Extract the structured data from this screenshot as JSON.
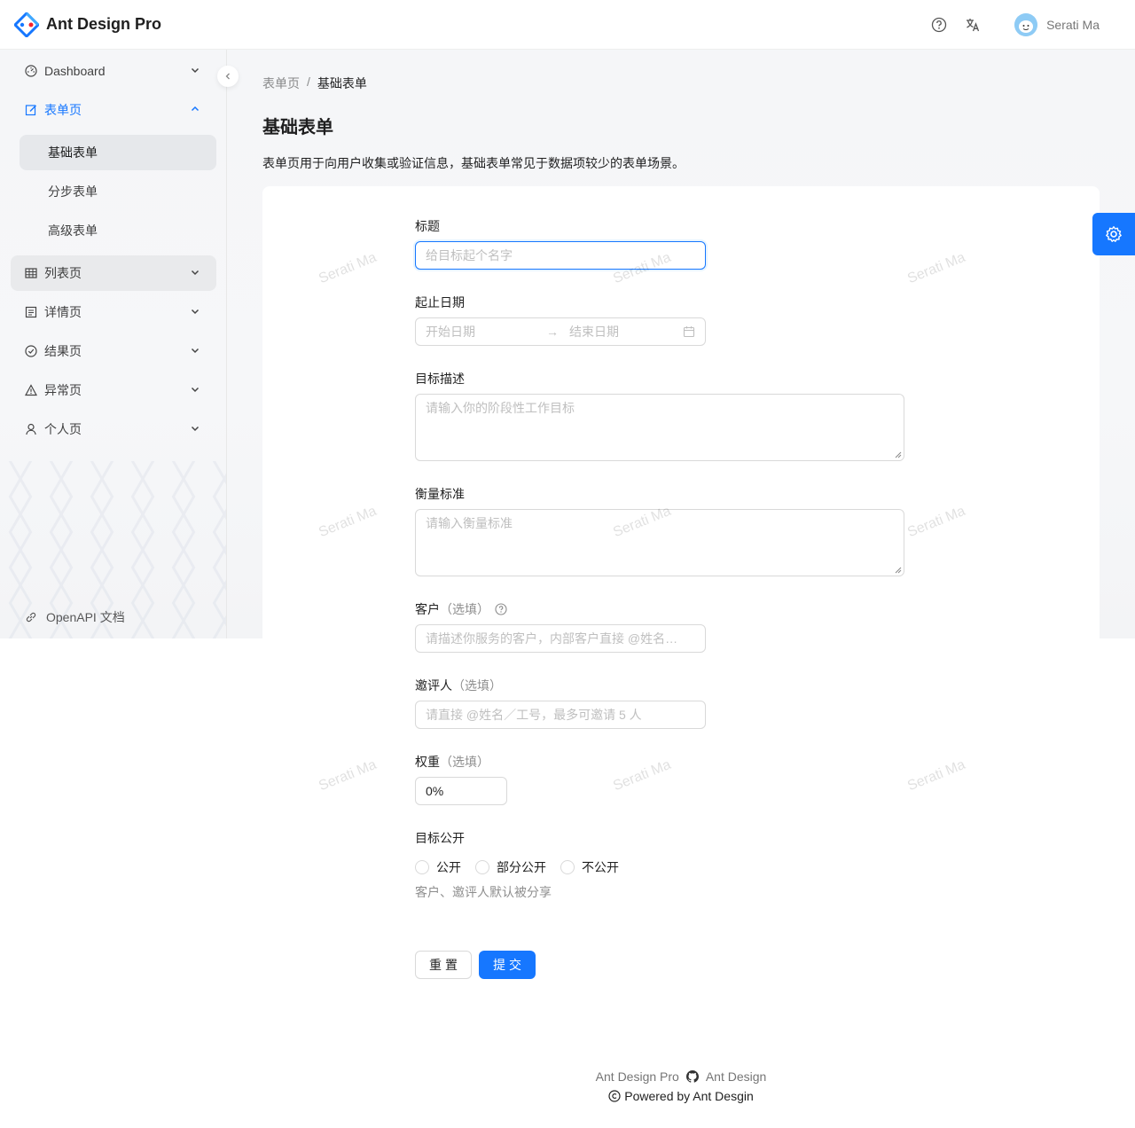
{
  "app": {
    "title": "Ant Design Pro",
    "brand_color": "#1677ff"
  },
  "header": {
    "user_name": "Serati Ma",
    "icons": [
      "question-circle-icon",
      "translation-icon"
    ]
  },
  "sidebar": {
    "items": [
      {
        "label": "Dashboard",
        "icon": "dashboard-icon"
      },
      {
        "label": "表单页",
        "icon": "form-icon"
      },
      {
        "label": "列表页",
        "icon": "table-icon"
      },
      {
        "label": "详情页",
        "icon": "profile-icon"
      },
      {
        "label": "结果页",
        "icon": "check-circle-icon"
      },
      {
        "label": "异常页",
        "icon": "warning-icon"
      },
      {
        "label": "个人页",
        "icon": "user-icon"
      }
    ],
    "sub_items": [
      {
        "label": "基础表单"
      },
      {
        "label": "分步表单"
      },
      {
        "label": "高级表单"
      }
    ],
    "openapi_label": "OpenAPI 文档"
  },
  "breadcrumb": [
    "表单页",
    "基础表单"
  ],
  "page": {
    "title": "基础表单",
    "description": "表单页用于向用户收集或验证信息，基础表单常见于数据项较少的表单场景。"
  },
  "form": {
    "title_label": "标题",
    "title_placeholder": "给目标起个名字",
    "date_label": "起止日期",
    "start_placeholder": "开始日期",
    "end_placeholder": "结束日期",
    "goal_label": "目标描述",
    "goal_placeholder": "请输入你的阶段性工作目标",
    "standard_label": "衡量标准",
    "standard_placeholder": "请输入衡量标准",
    "client_label": "客户",
    "client_optional": "（选填）",
    "client_placeholder": "请描述你服务的客户，内部客户直接 @姓名／工号",
    "invites_label": "邀评人",
    "invites_optional": "（选填）",
    "invites_placeholder": "请直接 @姓名／工号，最多可邀请 5 人",
    "weight_label": "权重",
    "weight_optional": "（选填）",
    "weight_value": "0%",
    "public_label": "目标公开",
    "public_options": [
      "公开",
      "部分公开",
      "不公开"
    ],
    "public_extra": "客户、邀评人默认被分享",
    "reset_label": "重置",
    "submit_label": "提交"
  },
  "watermark": "Serati Ma",
  "footer": {
    "link1": "Ant Design Pro",
    "link2": "Ant Design",
    "copyright": "Powered by Ant Desgin"
  }
}
